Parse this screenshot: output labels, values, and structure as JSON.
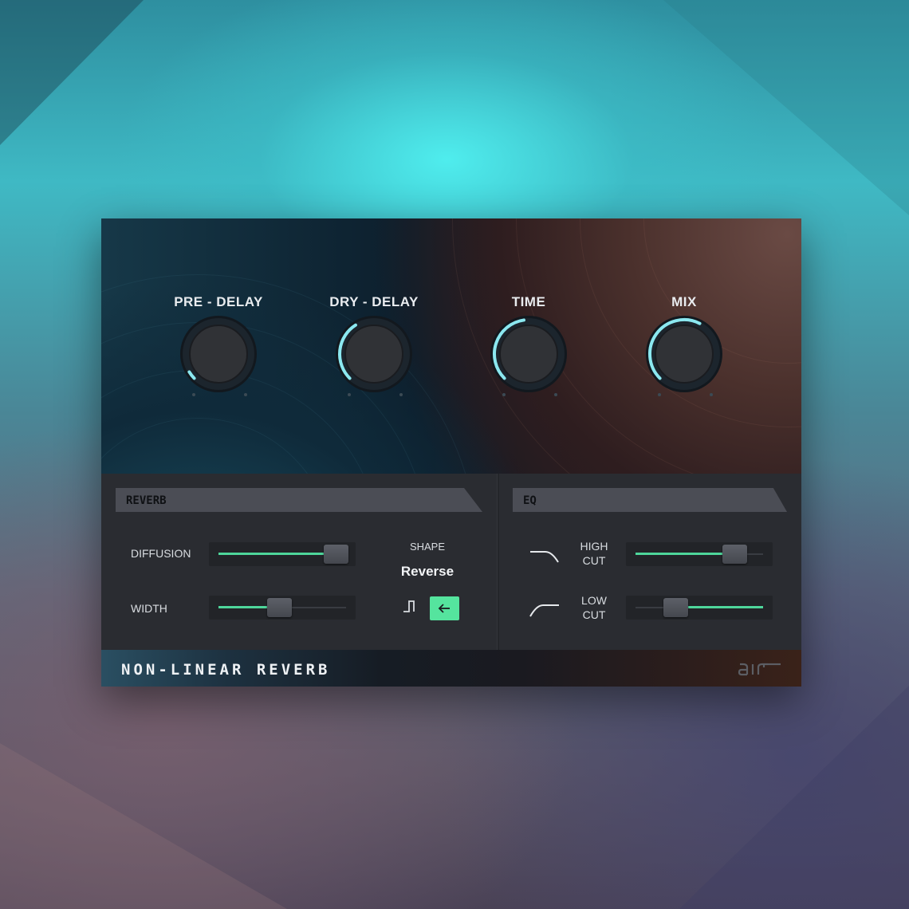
{
  "colors": {
    "accent": "#4ed69b",
    "knob_arc": "#8be8f0",
    "panel": "#2a2c31",
    "header_bar": "#4b4d55"
  },
  "knobs": [
    {
      "label": "PRE - DELAY",
      "level": 0.05
    },
    {
      "label": "DRY - DELAY",
      "level": 0.38
    },
    {
      "label": "TIME",
      "level": 0.47
    },
    {
      "label": "MIX",
      "level": 0.6
    }
  ],
  "reverb": {
    "title": "REVERB",
    "diffusion": {
      "label": "DIFFUSION",
      "level": 1.0
    },
    "width": {
      "label": "WIDTH",
      "level": 0.45
    },
    "shape": {
      "label": "SHAPE",
      "value": "Reverse",
      "buttons": [
        {
          "name": "normal",
          "icon": "step-pulse-icon",
          "active": false
        },
        {
          "name": "reverse",
          "icon": "arrow-left-icon",
          "active": true
        }
      ]
    }
  },
  "eq": {
    "title": "EQ",
    "high_cut": {
      "label_line1": "HIGH",
      "label_line2": "CUT",
      "icon": "high-cut-curve-icon",
      "level": 0.82
    },
    "low_cut": {
      "label_line1": "LOW",
      "label_line2": "CUT",
      "icon": "low-cut-curve-icon",
      "level": 0.25
    }
  },
  "footer": {
    "product_name": "NON-LINEAR REVERB",
    "brand": "air"
  }
}
